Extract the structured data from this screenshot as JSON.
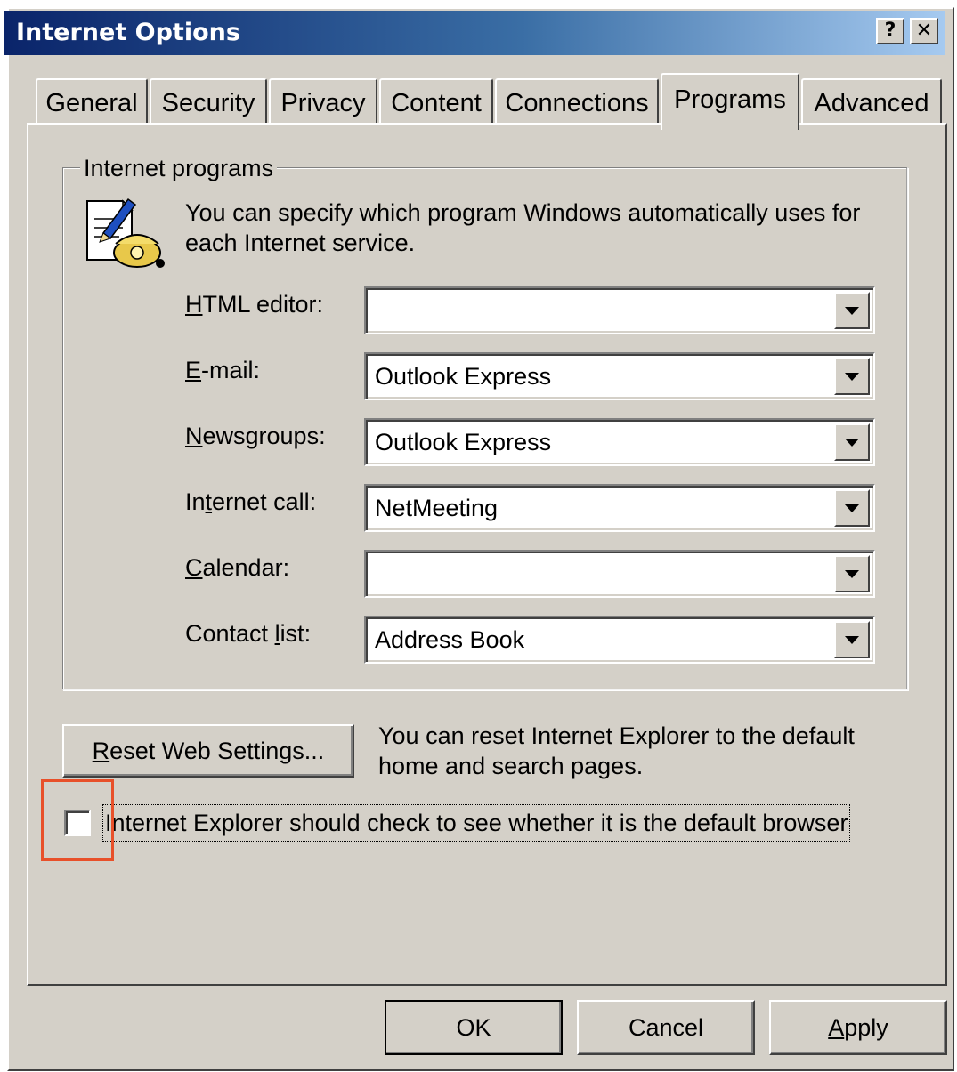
{
  "window": {
    "title": "Internet Options",
    "help_button": "?",
    "close_button": "✕"
  },
  "tabs": [
    {
      "label": "General",
      "active": false
    },
    {
      "label": "Security",
      "active": false
    },
    {
      "label": "Privacy",
      "active": false
    },
    {
      "label": "Content",
      "active": false
    },
    {
      "label": "Connections",
      "active": false
    },
    {
      "label": "Programs",
      "active": true
    },
    {
      "label": "Advanced",
      "active": false
    }
  ],
  "programs": {
    "group_title": "Internet programs",
    "icon": "programs-icon",
    "description": "You can specify which program Windows automatically uses for each Internet service.",
    "fields": [
      {
        "label": "HTML editor:",
        "value": ""
      },
      {
        "label": "E-mail:",
        "value": "Outlook Express"
      },
      {
        "label": "Newsgroups:",
        "value": "Outlook Express"
      },
      {
        "label": "Internet call:",
        "value": "NetMeeting"
      },
      {
        "label": "Calendar:",
        "value": ""
      },
      {
        "label": "Contact list:",
        "value": "Address Book"
      }
    ]
  },
  "reset": {
    "button_label": "Reset Web Settings...",
    "description": "You can reset Internet Explorer to the default home and search pages."
  },
  "default_check": {
    "label": "Internet Explorer should check to see whether it is the default browser",
    "checked": false
  },
  "footer": {
    "ok_label": "OK",
    "cancel_label": "Cancel",
    "apply_label": "Apply"
  },
  "colors": {
    "dialog_bg": "#d4d0c8",
    "title_start": "#0a246a",
    "title_end": "#a6caf0",
    "highlight": "#e8502a"
  }
}
